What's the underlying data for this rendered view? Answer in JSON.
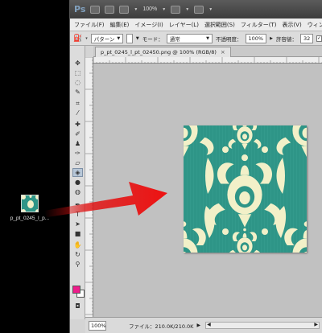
{
  "desktop": {
    "file_icon_label": "p_pt_0245_l_p..."
  },
  "titlebar": {
    "app_logo": "Ps",
    "br_button": "Br",
    "mb_button": "Mb",
    "zoom": "100%"
  },
  "menubar": {
    "items": [
      "ファイル(F)",
      "編集(E)",
      "イメージ(I)",
      "レイヤー(L)",
      "選択範囲(S)",
      "フィルター(T)",
      "表示(V)",
      "ウィンドウ"
    ]
  },
  "options": {
    "tool_mode": "パターン",
    "mode_label": "モード：",
    "mode_value": "通常",
    "opacity_label": "不透明度：",
    "opacity_value": "100%",
    "tolerance_label": "許容値：",
    "tolerance_value": "32"
  },
  "document": {
    "tab_title": "p_pt_0245_l_pt_02450.png @ 100% (RGB/8)",
    "close_glyph": "×"
  },
  "colors": {
    "foreground": "#ee1c8b",
    "background": "#ffffff",
    "pattern_teal": "#2e9587",
    "pattern_cream": "#f2f0c8",
    "arrow_red": "#e01010"
  },
  "statusbar": {
    "zoom": "100%",
    "file_info": "ファイル：210.0K/210.0K"
  },
  "tools": [
    "move-tool",
    "marquee-tool",
    "lasso-tool",
    "quick-select-tool",
    "crop-tool",
    "eyedropper-tool",
    "healing-tool",
    "brush-tool",
    "clone-stamp-tool",
    "history-brush-tool",
    "eraser-tool",
    "paint-bucket-tool",
    "blur-tool",
    "dodge-tool",
    "pen-tool",
    "type-tool",
    "path-select-tool",
    "shape-tool",
    "hand-tool",
    "zoom-tool"
  ]
}
